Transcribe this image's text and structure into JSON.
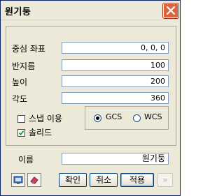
{
  "window": {
    "title": "원기둥"
  },
  "fields": {
    "center": {
      "label": "중심 좌표",
      "value": "0, 0, 0"
    },
    "radius": {
      "label": "반지름",
      "value": "100"
    },
    "height": {
      "label": "높이",
      "value": "200"
    },
    "angle": {
      "label": "각도",
      "value": "360"
    }
  },
  "options": {
    "snap": {
      "label": "스냅 이용",
      "checked": false
    },
    "solid": {
      "label": "솔리드",
      "checked": true
    },
    "coord_system": {
      "options": [
        "GCS",
        "WCS"
      ],
      "selected": "GCS"
    }
  },
  "name": {
    "label": "이름",
    "value": "원기둥"
  },
  "buttons": {
    "ok": "확인",
    "cancel": "취소",
    "apply": "적용",
    "more": "»"
  },
  "icons": {
    "left1": "screen-icon",
    "left2": "eraser-icon"
  }
}
